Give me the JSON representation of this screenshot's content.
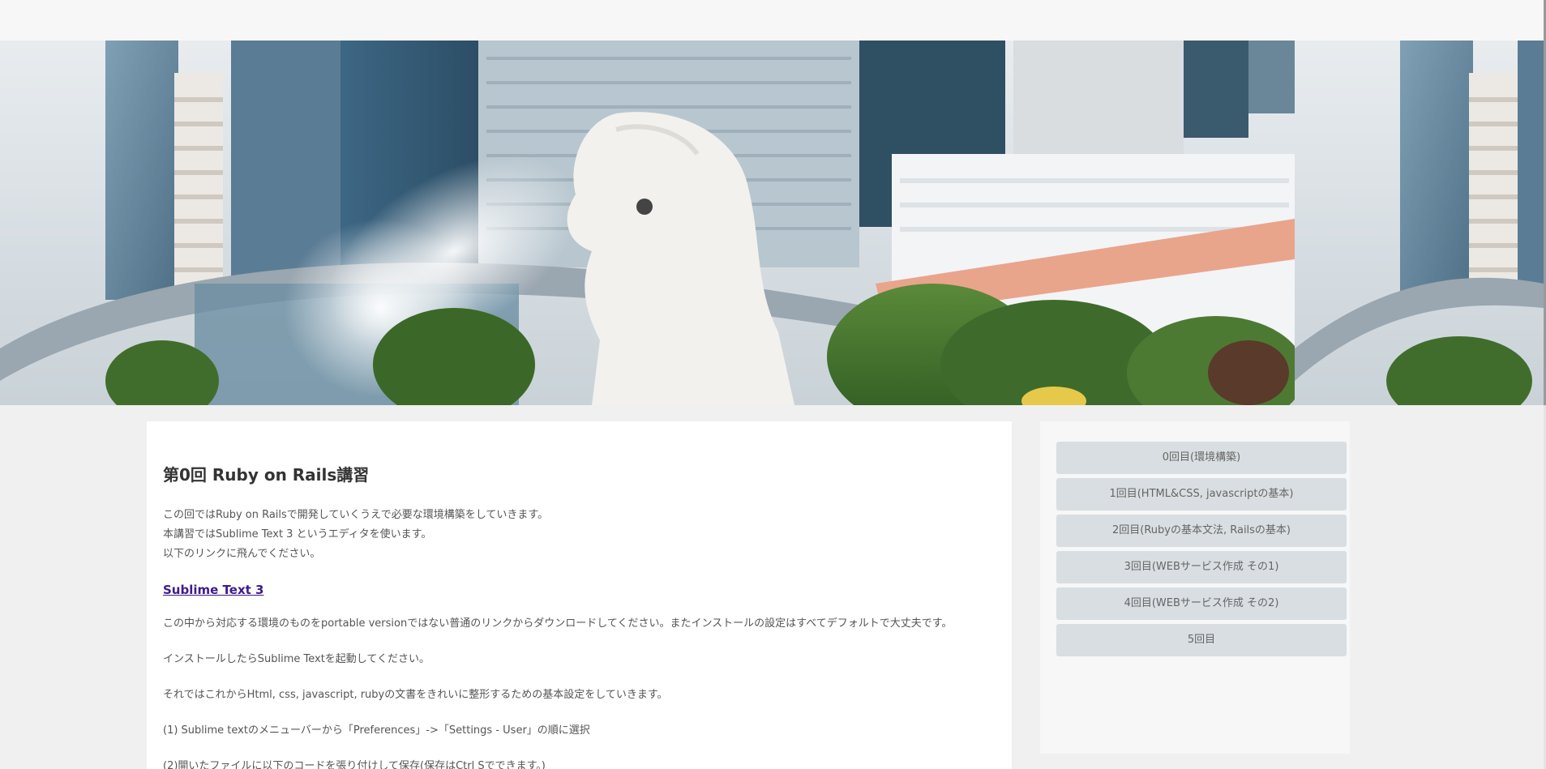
{
  "hero": {
    "image": "merlion-skyline-photo"
  },
  "article": {
    "title": "第0回 Ruby on Rails講習",
    "intro_lines": [
      "この回ではRuby on Railsで開発していくうえで必要な環境構築をしていきます。",
      "本講習ではSublime Text 3 というエディタを使います。",
      "以下のリンクに飛んでください。"
    ],
    "link_text": "Sublime Text 3",
    "paragraphs": [
      "この中から対応する環境のものをportable versionではない普通のリンクからダウンロードしてください。またインストールの設定はすべてデフォルトで大丈夫です。",
      "インストールしたらSublime Textを起動してください。",
      "それではこれからHtml, css, javascript, rubyの文書をきれいに整形するための基本設定をしていきます。",
      "(1) Sublime textのメニューバーから「Preferences」->「Settings - User」の順に選択",
      "(2)開いたファイルに以下のコードを張り付けして保存(保存はCtrl Sでできます。)"
    ]
  },
  "sidebar": {
    "items": [
      {
        "label": "0回目(環境構築)"
      },
      {
        "label": "1回目(HTML&CSS, javascriptの基本)"
      },
      {
        "label": "2回目(Rubyの基本文法, Railsの基本)"
      },
      {
        "label": "3回目(WEBサービス作成 その1)"
      },
      {
        "label": "4回目(WEBサービス作成 その2)"
      },
      {
        "label": "5回目"
      }
    ]
  },
  "colors": {
    "link": "#3d1b8c",
    "nav_bg": "#d8dee1",
    "page_bg": "#f0f0f0"
  }
}
